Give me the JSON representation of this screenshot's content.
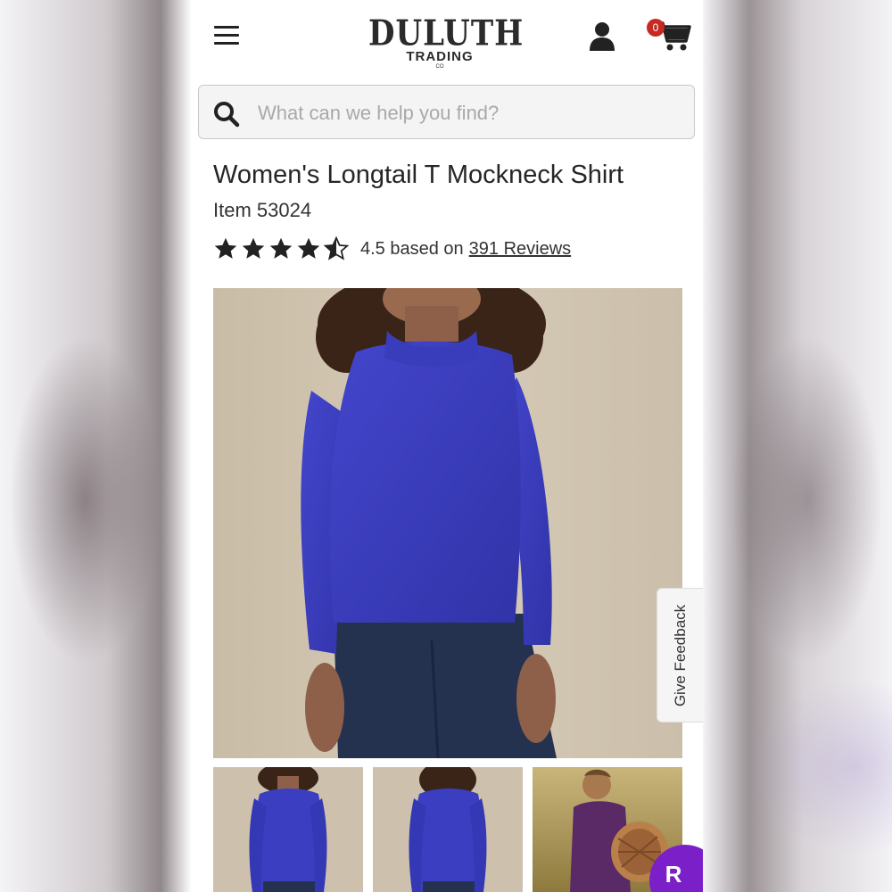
{
  "header": {
    "logo": {
      "main": "DULUTH",
      "sub": "TRADING",
      "co": "CO"
    },
    "cart_count": "0",
    "icons": {
      "menu": "hamburger-menu-icon",
      "account": "user-icon",
      "cart": "shopping-cart-icon"
    }
  },
  "search": {
    "placeholder": "What can we help you find?",
    "value": "",
    "icon": "search-icon"
  },
  "product": {
    "title": "Women's Longtail T Mockneck Shirt",
    "item_number": "Item 53024",
    "rating": 4.5,
    "rating_text": "4.5 based on",
    "reviews_link": "391 Reviews"
  },
  "feedback": {
    "label": "Give Feedback"
  },
  "rakuten": {
    "label": "R"
  },
  "colors": {
    "shirt_blue": "#3b3ec0",
    "thumb_purple": "#5a2a66",
    "rakuten_purple": "#7b1fc9",
    "badge_red": "#c72a22"
  }
}
